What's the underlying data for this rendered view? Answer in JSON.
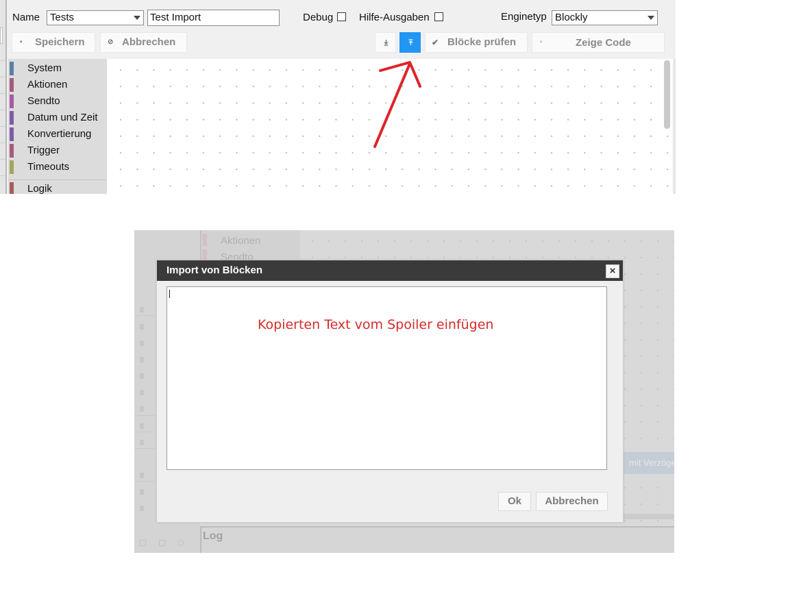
{
  "editor": {
    "name_label": "Name",
    "folder_value": "Tests",
    "script_name_value": "Test Import",
    "debug_label": "Debug",
    "help_label": "Hilfe-Ausgaben",
    "engine_label": "Enginetyp",
    "engine_value": "Blockly"
  },
  "toolbar": {
    "save_label": "Speichern",
    "cancel_label": "Abbrechen",
    "export_icon": "download-icon",
    "import_icon": "upload-icon",
    "check_label": "Blöcke prüfen",
    "show_code_label": "Zeige Code"
  },
  "toolbox": {
    "categories": [
      {
        "label": "System",
        "color": "#5b80a5"
      },
      {
        "label": "Aktionen",
        "color": "#a55b80"
      },
      {
        "label": "Sendto",
        "color": "#a55ba5"
      },
      {
        "label": "Datum und Zeit",
        "color": "#805ba5"
      },
      {
        "label": "Konvertierung",
        "color": "#805ba5"
      },
      {
        "label": "Trigger",
        "color": "#a55b80"
      },
      {
        "label": "Timeouts",
        "color": "#a5a55b"
      },
      {
        "label": "Logik",
        "color": "#a55b5b"
      }
    ]
  },
  "background": {
    "category_1": "Aktionen",
    "category_2": "Sendto",
    "delay_button": "mit Verzögerung",
    "log_label": "Log"
  },
  "dialog": {
    "title": "Import von Blöcken",
    "close_symbol": "×",
    "import_value": "",
    "annotation_text": "Kopierten Text vom Spoiler einfügen",
    "ok_label": "Ok",
    "cancel_label": "Abbrechen"
  },
  "colors": {
    "accent_active": "#2196f3",
    "annotation_red": "#e0232b",
    "dialog_header": "#3a3a3a"
  }
}
